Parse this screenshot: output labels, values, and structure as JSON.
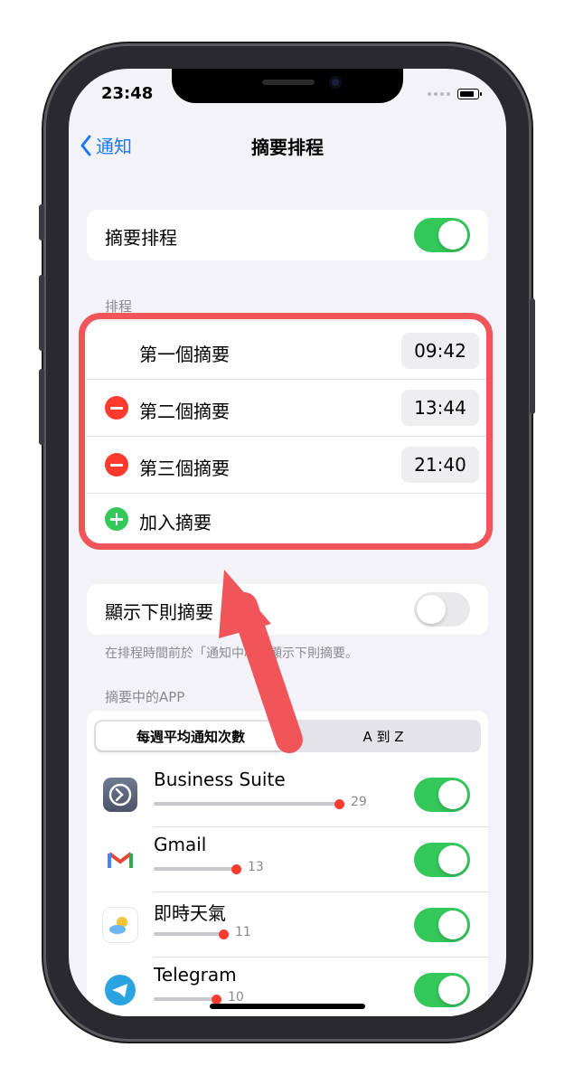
{
  "status_bar": {
    "time": "23:48"
  },
  "nav": {
    "back_label": "通知",
    "title": "摘要排程"
  },
  "schedule_toggle": {
    "label": "摘要排程",
    "on": true
  },
  "schedule_section": {
    "header": "排程",
    "items": [
      {
        "label": "第一個摘要",
        "time": "09:42",
        "removable": false
      },
      {
        "label": "第二個摘要",
        "time": "13:44",
        "removable": true
      },
      {
        "label": "第三個摘要",
        "time": "21:40",
        "removable": true
      }
    ],
    "add_label": "加入摘要"
  },
  "next_summary": {
    "label": "顯示下則摘要",
    "on": false,
    "footer": "在排程時間前於「通知中心」顯示下則摘要。"
  },
  "apps_section": {
    "header": "摘要中的APP",
    "segments": [
      "每週平均通知次數",
      "A 到 Z"
    ],
    "selected_segment": 0,
    "apps": [
      {
        "name": "Business Suite",
        "count": "29",
        "on": true,
        "icon": "business-suite-icon"
      },
      {
        "name": "Gmail",
        "count": "13",
        "on": true,
        "icon": "gmail-icon"
      },
      {
        "name": "即時天氣",
        "count": "11",
        "on": true,
        "icon": "weather-icon"
      },
      {
        "name": "Telegram",
        "count": "10",
        "on": true,
        "icon": "telegram-icon"
      }
    ]
  },
  "colors": {
    "accent": "#1a78f2",
    "toggle_on": "#34c759",
    "destructive": "#ff3b30",
    "highlight": "#f0555a"
  }
}
